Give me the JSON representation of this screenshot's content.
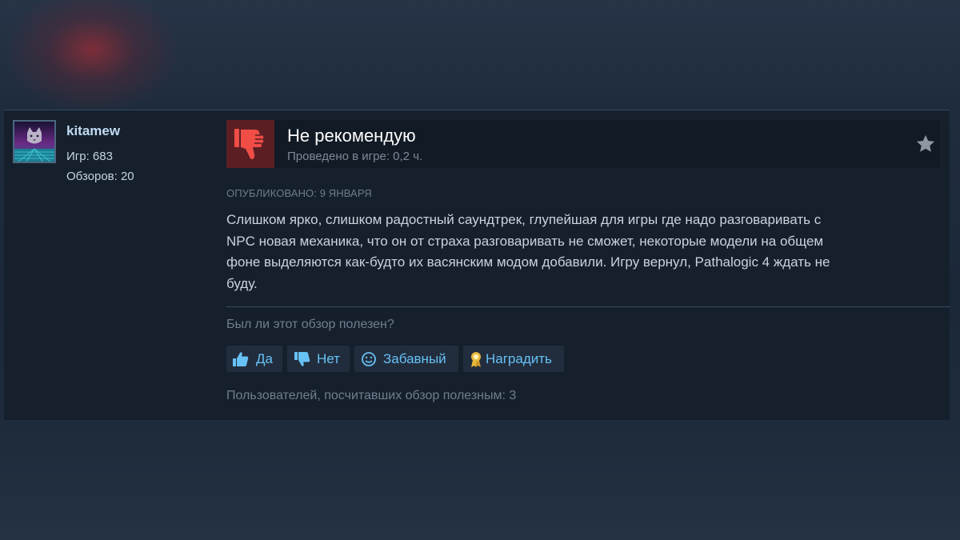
{
  "author": {
    "name": "kitamew",
    "games": "Игр: 683",
    "reviews": "Обзоров: 20"
  },
  "verdict": {
    "title": "Не рекомендую",
    "hours": "Проведено в игре: 0,2 ч.",
    "icon": "thumbs-down-icon",
    "icon_color": "#f04d47"
  },
  "posted": "ОПУБЛИКОВАНО: 9 ЯНВАРЯ",
  "review_lines": [
    "Слишком ярко, слишком радостный саундтрек, глупейшая для игры где надо разговаривать с",
    "NPC новая механика, что он от страха разговаривать не сможет, некоторые модели на общем",
    "фоне выделяются как-будто их васянским модом добавили. Игру вернул, Pathalogic 4 ждать не",
    "буду."
  ],
  "helpful_question": "Был ли этот обзор полезен?",
  "vote_buttons": {
    "yes": "Да",
    "no": "Нет",
    "funny": "Забавный",
    "award": "Наградить"
  },
  "helpful_count": "Пользователей, посчитавших обзор полезным: 3",
  "colors": {
    "accent_link": "#67c1f5",
    "author_name": "#c1dbf4",
    "award_gold": "#e8b83a"
  }
}
